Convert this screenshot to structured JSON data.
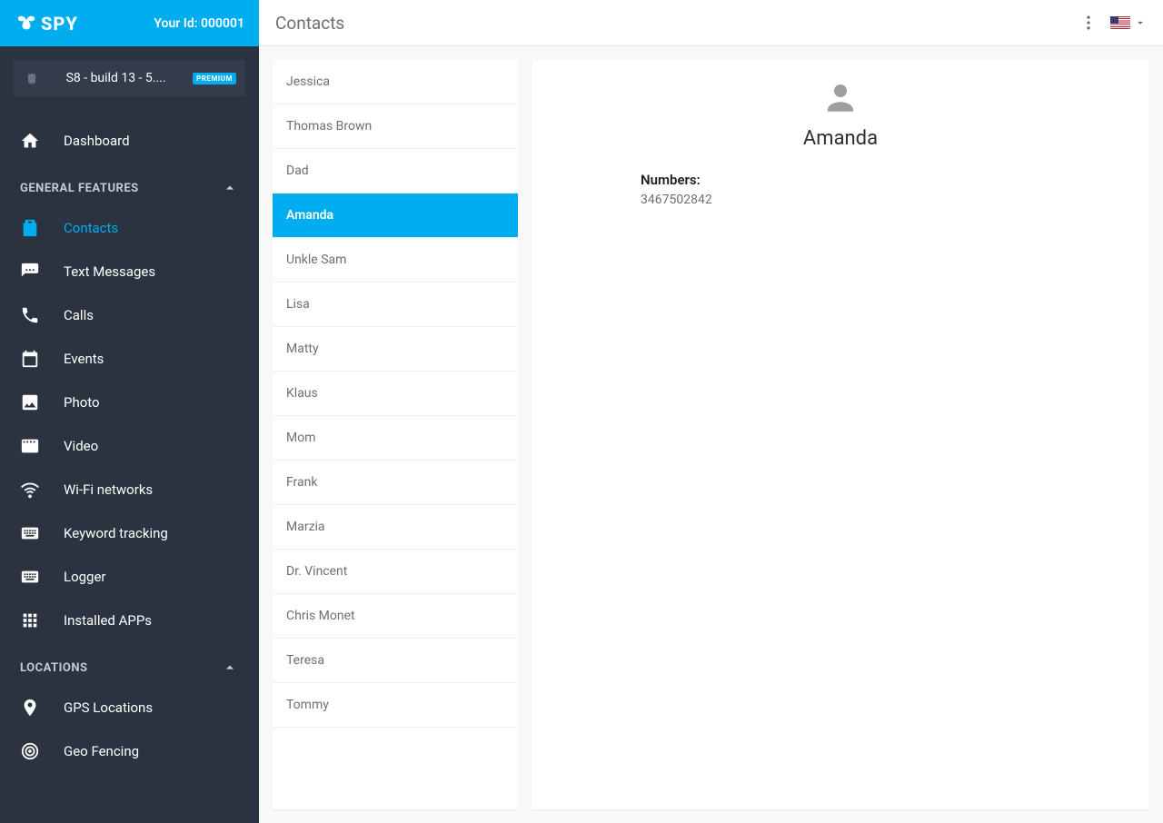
{
  "brand": "SPY",
  "header": {
    "your_id_label": "Your Id: 000001",
    "page_title": "Contacts"
  },
  "device": {
    "name": "S8 - build 13 - 5....",
    "badge": "PREMIUM"
  },
  "nav": {
    "dashboard": "Dashboard",
    "sections": [
      {
        "title": "GENERAL FEATURES",
        "items": [
          {
            "key": "contacts",
            "label": "Contacts",
            "icon": "clipboard",
            "active": true
          },
          {
            "key": "text-messages",
            "label": "Text Messages",
            "icon": "sms"
          },
          {
            "key": "calls",
            "label": "Calls",
            "icon": "phone"
          },
          {
            "key": "events",
            "label": "Events",
            "icon": "event"
          },
          {
            "key": "photo",
            "label": "Photo",
            "icon": "image"
          },
          {
            "key": "video",
            "label": "Video",
            "icon": "video"
          },
          {
            "key": "wifi",
            "label": "Wi-Fi networks",
            "icon": "wifi"
          },
          {
            "key": "keyword",
            "label": "Keyword tracking",
            "icon": "keyboard"
          },
          {
            "key": "logger",
            "label": "Logger",
            "icon": "keyboard"
          },
          {
            "key": "apps",
            "label": "Installed APPs",
            "icon": "apps"
          }
        ]
      },
      {
        "title": "LOCATIONS",
        "items": [
          {
            "key": "gps",
            "label": "GPS Locations",
            "icon": "pin"
          },
          {
            "key": "geofence",
            "label": "Geo Fencing",
            "icon": "target"
          }
        ]
      }
    ]
  },
  "contacts": [
    {
      "name": "Jessica"
    },
    {
      "name": "Thomas Brown"
    },
    {
      "name": "Dad"
    },
    {
      "name": "Amanda",
      "selected": true
    },
    {
      "name": "Unkle Sam"
    },
    {
      "name": "Lisa"
    },
    {
      "name": "Matty"
    },
    {
      "name": "Klaus"
    },
    {
      "name": "Mom"
    },
    {
      "name": "Frank"
    },
    {
      "name": "Marzia"
    },
    {
      "name": "Dr. Vincent"
    },
    {
      "name": "Chris Monet"
    },
    {
      "name": "Teresa"
    },
    {
      "name": "Tommy"
    }
  ],
  "detail": {
    "name": "Amanda",
    "numbers_label": "Numbers:",
    "numbers": [
      "3467502842"
    ]
  }
}
